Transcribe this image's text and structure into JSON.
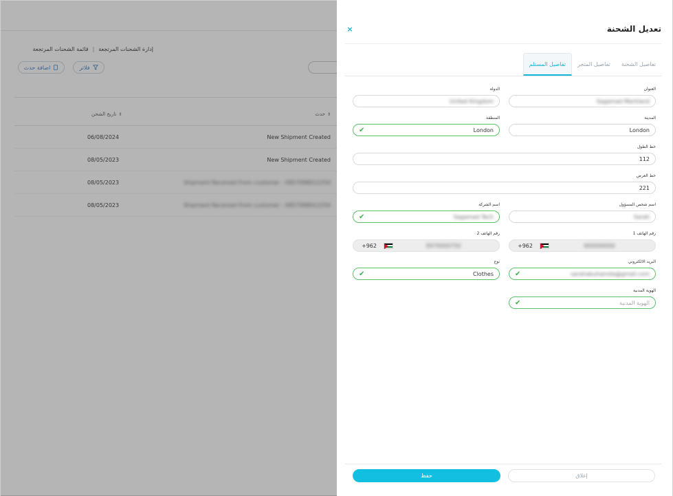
{
  "background": {
    "breadcrumb": [
      "إدارة الشحنات المرتجعة",
      "قائمة الشحنات المرتجعة"
    ],
    "breadcrumb_sep": "|",
    "filters_label": "فلاتر",
    "add_event_label": "اضافة حدث",
    "columns": [
      "تاريخ الشحن",
      "حدث"
    ],
    "rows": [
      {
        "date": "06/08/2024",
        "desc": "New Shipment Created"
      },
      {
        "date": "08/05/2023",
        "desc": "New Shipment Created"
      },
      {
        "date": "08/05/2023",
        "desc": "Shipment Received From customer - 0957098012250"
      },
      {
        "date": "08/05/2023",
        "desc": "Shipment Received From customer - 0957098012250"
      }
    ]
  },
  "panel": {
    "title": "تعديل الشحنة",
    "close_symbol": "×",
    "tabs": [
      {
        "label": "تفاصيل الشحنة",
        "active": false
      },
      {
        "label": "تفاصيل المتجر",
        "active": false
      },
      {
        "label": "تفاصيل المستلم",
        "active": true
      }
    ],
    "fields": {
      "address": {
        "label": "العنوان",
        "value": "Sagamad Markland"
      },
      "country": {
        "label": "الدولة",
        "value": "United Kingdom"
      },
      "city": {
        "label": "المدينة",
        "value": "London"
      },
      "region": {
        "label": "المنطقة",
        "value": "London"
      },
      "longitude": {
        "label": "خط الطول",
        "value": "112"
      },
      "latitude": {
        "label": "خط العرض",
        "value": "221"
      },
      "contact_person": {
        "label": "اسم شخص المسؤول",
        "value": "Sarah"
      },
      "company_name": {
        "label": "اسم الشركة",
        "value": "Sagamad Tech"
      },
      "phone1": {
        "label": "رقم الهاتف 1",
        "code": "+962",
        "number": "000000000"
      },
      "phone2": {
        "label": "رقم الهاتف 2",
        "code": "+962",
        "number": "0970000750"
      },
      "email": {
        "label": "البريد الالكتروني",
        "value": "sarahabuhamda@gmail.com"
      },
      "type": {
        "label": "نوع",
        "value": "Clothes"
      },
      "national_id": {
        "label": "الهوية المدنية",
        "placeholder": "الهوية المدنية"
      }
    },
    "save_label": "حفظ",
    "close_label": "إغلاق"
  },
  "colors": {
    "accent": "#13bfe0",
    "valid": "#5cc26a"
  }
}
